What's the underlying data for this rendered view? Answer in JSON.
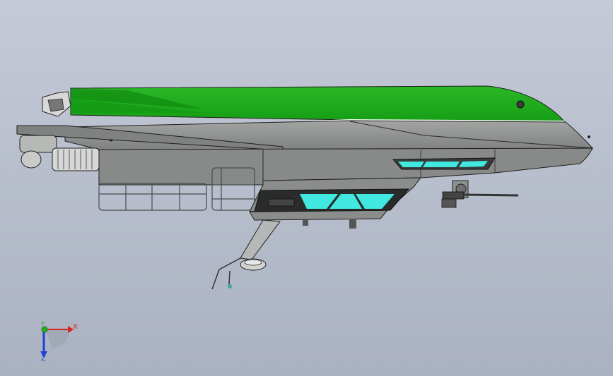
{
  "viewport": {
    "background_top": "#c4cad6",
    "background_bottom": "#aab1c1"
  },
  "model": {
    "hull_green": "#22a81e",
    "hull_green_dark": "#138a14",
    "hull_grey": "#8f918f",
    "hull_grey_dark": "#6e716f",
    "window_cyan": "#40e8e0",
    "outline": "#1e1e1e"
  },
  "triad": {
    "x_label": "X",
    "y_label": "Y",
    "z_label": "Z",
    "x_color": "#e02020",
    "y_color": "#20b020",
    "z_color": "#2040d0"
  }
}
